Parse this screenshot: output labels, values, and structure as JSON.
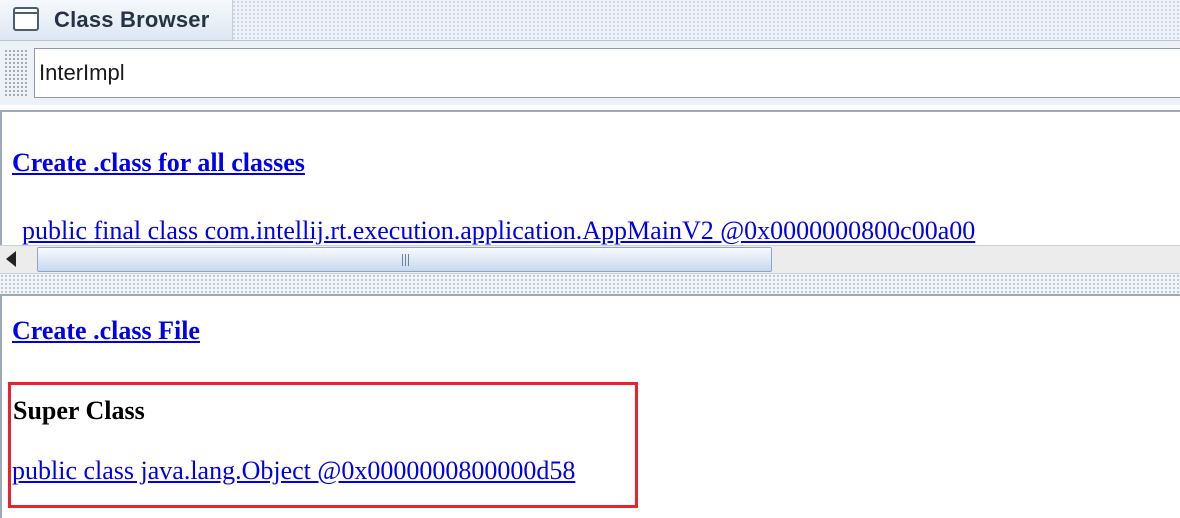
{
  "window": {
    "title": "Class Browser",
    "icon": "window-icon"
  },
  "search": {
    "value": "InterImpl"
  },
  "top_pane": {
    "create_all_link": "Create .class for all classes",
    "class_link": "public final class com.intellij.rt.execution.application.AppMainV2 @0x0000000800c00a00"
  },
  "bottom_pane": {
    "create_file_link": "Create .class File",
    "super_class_heading": "Super Class",
    "super_class_link": "public class java.lang.Object @0x0000000800000d58"
  },
  "colors": {
    "link": "#0000ee",
    "highlight_box": "#e8232e",
    "title_text": "#243345"
  }
}
